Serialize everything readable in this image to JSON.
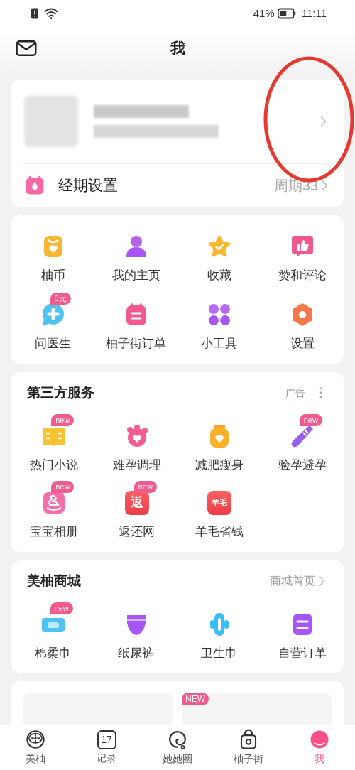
{
  "status_bar": {
    "battery": "41%",
    "time": "11:11"
  },
  "header": {
    "title": "我"
  },
  "profile": {
    "redacted": true
  },
  "annotation": {
    "kind": "ellipse"
  },
  "cycle": {
    "label": "经期设置",
    "value": "周期33"
  },
  "shortcuts": [
    {
      "label": "柚币"
    },
    {
      "label": "我的主页"
    },
    {
      "label": "收藏"
    },
    {
      "label": "赞和评论"
    },
    {
      "label": "问医生",
      "badge": "0元"
    },
    {
      "label": "柚子街订单"
    },
    {
      "label": "小工具"
    },
    {
      "label": "设置"
    }
  ],
  "third_party": {
    "title": "第三方服务",
    "ad_label": "广告",
    "items": [
      {
        "label": "热门小说",
        "badge": "new"
      },
      {
        "label": "难孕调理"
      },
      {
        "label": "减肥瘦身"
      },
      {
        "label": "验孕避孕",
        "badge": "new"
      },
      {
        "label": "宝宝相册",
        "badge": "new"
      },
      {
        "label": "返还网",
        "badge": "new",
        "icon_text": "返"
      },
      {
        "label": "羊毛省钱",
        "icon_text": "羊毛"
      }
    ]
  },
  "store": {
    "title": "美柚商城",
    "link": "商城首页",
    "items": [
      {
        "label": "棉柔巾",
        "badge": "new"
      },
      {
        "label": "纸尿裤"
      },
      {
        "label": "卫生巾"
      },
      {
        "label": "自营订单"
      }
    ]
  },
  "promo": {
    "badge": "NEW"
  },
  "tab_bar": [
    {
      "label": "美柚",
      "selected": false
    },
    {
      "label": "记录",
      "selected": false,
      "icon_text": "17"
    },
    {
      "label": "她她圈",
      "selected": false
    },
    {
      "label": "柚子街",
      "selected": false
    },
    {
      "label": "我",
      "selected": true
    }
  ]
}
